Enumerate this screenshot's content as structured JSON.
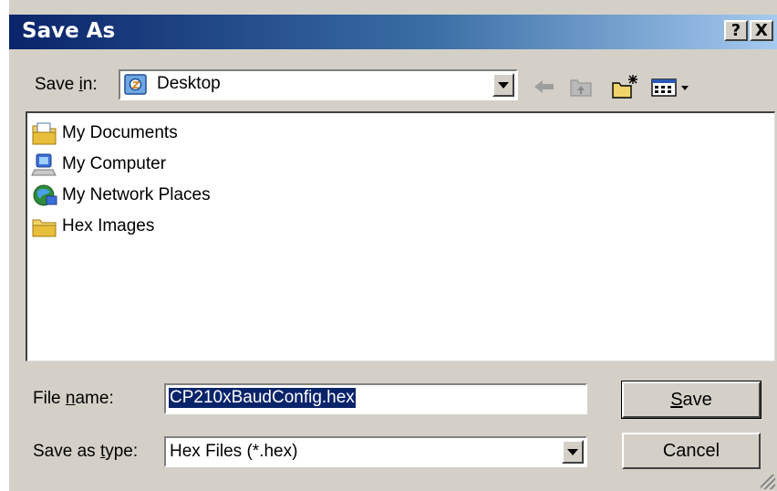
{
  "window": {
    "title": "Save As",
    "help_label": "?",
    "close_label": "X"
  },
  "save_in": {
    "label_pre": "Save ",
    "label_accel": "i",
    "label_post": "n:",
    "value": "Desktop",
    "icon": "desktop-icon"
  },
  "toolbar": [
    "back-icon",
    "up-folder-icon",
    "new-folder-icon",
    "view-menu-icon"
  ],
  "files": [
    {
      "name": "My Documents",
      "icon": "my-documents-icon"
    },
    {
      "name": "My Computer",
      "icon": "my-computer-icon"
    },
    {
      "name": "My Network Places",
      "icon": "network-places-icon"
    },
    {
      "name": "Hex Images",
      "icon": "folder-icon"
    }
  ],
  "file_name": {
    "label_pre": "File ",
    "label_accel": "n",
    "label_post": "ame:",
    "value": "CP210xBaudConfig.hex"
  },
  "save_type": {
    "label_pre": "Save as ",
    "label_accel": "t",
    "label_post": "ype:",
    "value": "Hex Files (*.hex)"
  },
  "buttons": {
    "save_accel": "S",
    "save_rest": "ave",
    "cancel": "Cancel"
  },
  "colors": {
    "title_start": "#0a246a",
    "title_end": "#a6caf0",
    "face": "#d4d0c8",
    "selection": "#0a246a"
  }
}
